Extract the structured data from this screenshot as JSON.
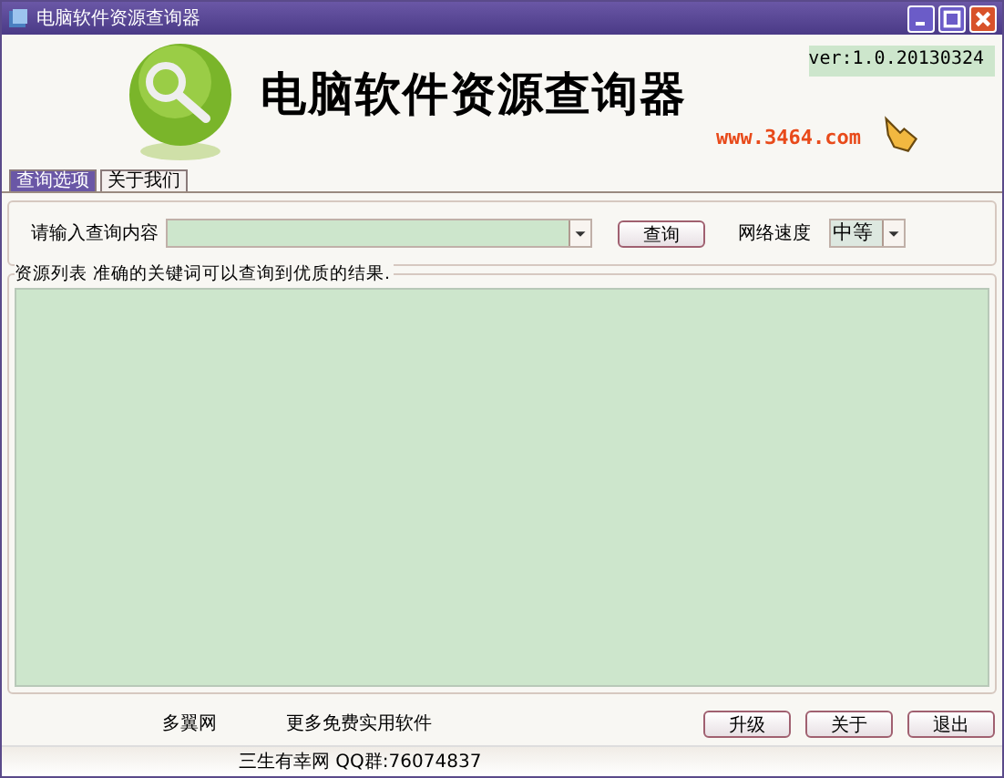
{
  "window": {
    "title": "电脑软件资源查询器"
  },
  "header": {
    "title": "电脑软件资源查询器",
    "version": "ver:1.0.20130324",
    "website": "www.3464.com"
  },
  "tabs": [
    {
      "label": "查询选项",
      "selected": true
    },
    {
      "label": "关于我们",
      "selected": false
    }
  ],
  "query": {
    "label": "请输入查询内容",
    "button": "查询",
    "speed_label": "网络速度",
    "speed_value": "中等"
  },
  "results": {
    "legend": "资源列表 准确的关键词可以查询到优质的结果."
  },
  "footer": {
    "links": [
      "多翼网",
      "更多免费实用软件"
    ],
    "buttons": [
      "升级",
      "关于",
      "退出"
    ],
    "status": "三生有幸网 QQ群:76074837"
  }
}
